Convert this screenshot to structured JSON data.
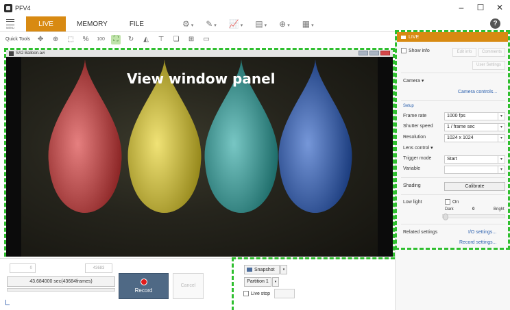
{
  "window": {
    "app_title": "PFV4",
    "minimize": "–",
    "maximize": "☐",
    "close": "✕"
  },
  "menu": {
    "menu_label": "MENU",
    "tabs": [
      {
        "label": "LIVE"
      },
      {
        "label": "MEMORY"
      },
      {
        "label": "FILE"
      }
    ]
  },
  "quick_tools": {
    "label": "Quick Tools",
    "zoom_100": "100"
  },
  "view_window": {
    "title": "SA2 Balloon.avi",
    "overlay_label": "View window panel"
  },
  "balloons": [
    {
      "color": "#d83b3b"
    },
    {
      "color": "#e8d32c"
    },
    {
      "color": "#2fa8a4"
    },
    {
      "color": "#2c5fc4"
    }
  ],
  "bottom": {
    "start_value": "0",
    "end_value": "43683",
    "duration": "43.684000 sec(43684frames)",
    "record_label": "Record",
    "cancel_label": "Cancel",
    "snapshot_label": "Snapshot",
    "partition_label": "Partition 1",
    "live_stop_label": "Live stop"
  },
  "right": {
    "header": "LIVE",
    "show_info": "Show info",
    "edit_info": "Edit info",
    "comments": "Comments",
    "user_settings": "User Settings",
    "camera": "Camera ▾",
    "camera_controls": "Camera controls...",
    "setup": "Setup",
    "frame_rate_label": "Frame rate",
    "frame_rate": "1000 fps",
    "shutter_label": "Shutter speed",
    "shutter": "1 / frame sec",
    "resolution_label": "Resolution",
    "resolution": "1024 x 1024",
    "lens_control": "Lens control ▾",
    "trigger_label": "Trigger mode",
    "trigger": "Start",
    "variable_label": "Variable",
    "variable": "",
    "shading_label": "Shading",
    "calibrate": "Calibrate",
    "low_light_label": "Low light",
    "on_label": "On",
    "dark": "Dark",
    "low_light_value": "0",
    "bright": "Bright",
    "related_label": "Related settings",
    "io_settings": "I/O settings...",
    "record_settings": "Record settings..."
  }
}
